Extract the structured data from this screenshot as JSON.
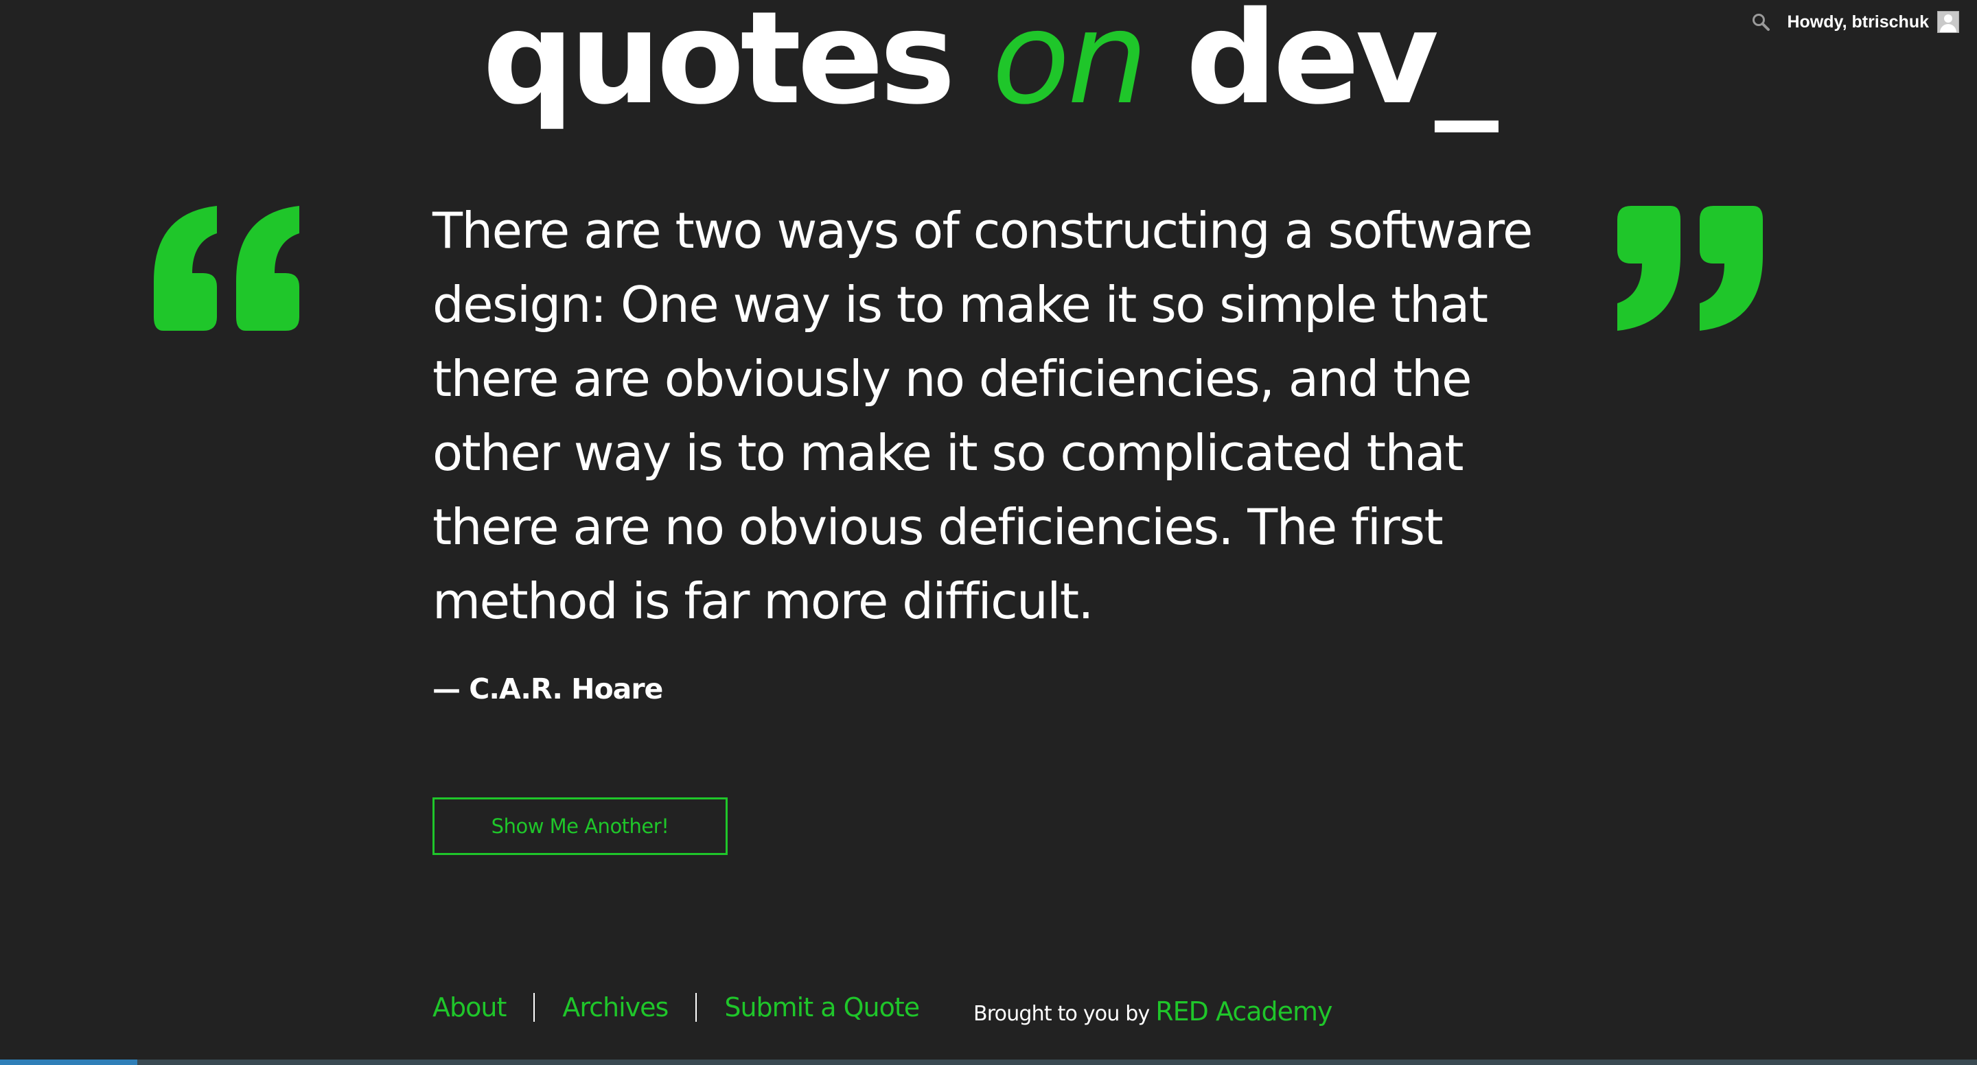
{
  "admin_bar": {
    "search_icon": "search-icon",
    "greeting": "Howdy, btrischuk",
    "avatar_icon": "user-avatar-icon"
  },
  "logo": {
    "part1": "quotes",
    "part2": "on",
    "part3": "dev_"
  },
  "colors": {
    "background": "#222222",
    "accent": "#1fc62a",
    "text": "#ffffff"
  },
  "quote": {
    "open_icon": "open-quote-icon",
    "close_icon": "close-quote-icon",
    "text": "There are two ways of constructing a software design: One way is to make it so simple that there are obviously no deficiencies, and the other way is to make it so complicated that there are no obvious deficiencies. The first method is far more difficult.",
    "author": "— C.A.R. Hoare"
  },
  "button": {
    "label": "Show Me Another!"
  },
  "footer": {
    "links": [
      "About",
      "Archives",
      "Submit a Quote"
    ],
    "credit_prefix": "Brought to you by",
    "credit_link": "RED Academy"
  }
}
